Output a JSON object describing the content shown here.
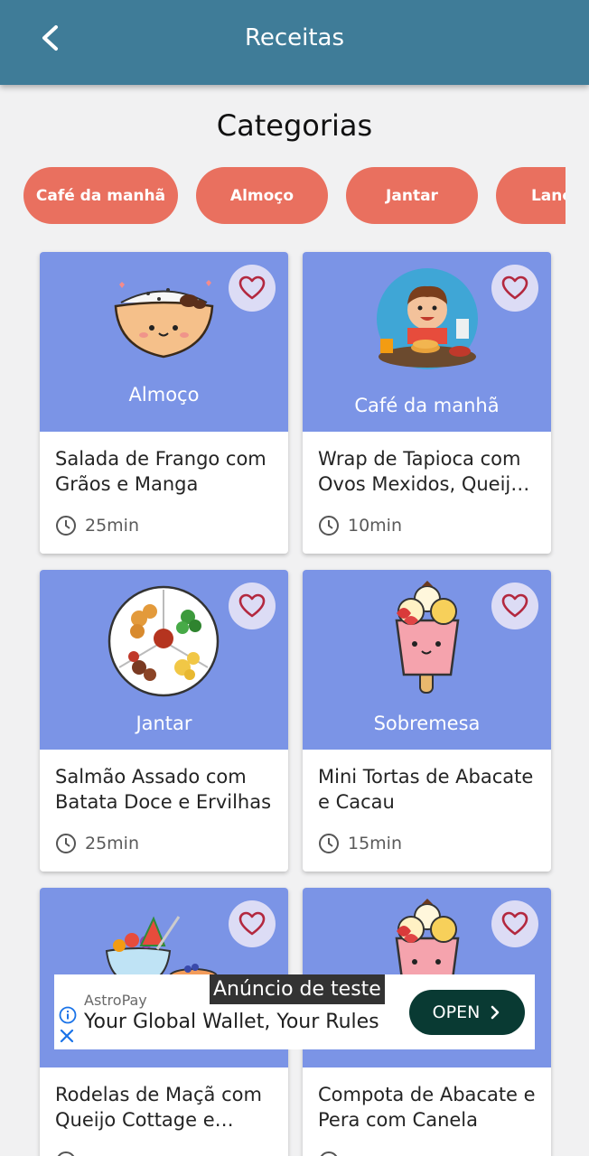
{
  "header": {
    "title": "Receitas",
    "back_icon": "chevron-left-icon"
  },
  "section_title": "Categorias",
  "categories": [
    "Café da manhã",
    "Almoço",
    "Jantar",
    "Lanche"
  ],
  "colors": {
    "appbar": "#3f7c98",
    "chip": "#e9705f",
    "card_image": "#7b94e6",
    "favorite_bg": "#dcdcf5",
    "heart": "#b3283f"
  },
  "recipes": [
    {
      "category": "Almoço",
      "title": "Salada de Frango com Grãos e Manga",
      "time": "25min",
      "image": "rice-bowl-icon",
      "favorite_icon": "heart-outline-icon"
    },
    {
      "category": "Café da manhã",
      "title": "Wrap de Tapioca com Ovos Mexidos, Queijo e Tomate",
      "time": "10min",
      "image": "breakfast-kid-icon",
      "favorite_icon": "heart-outline-icon"
    },
    {
      "category": "Jantar",
      "title": "Salmão Assado com Batata Doce e Ervilhas",
      "time": "25min",
      "image": "dinner-plate-icon",
      "favorite_icon": "heart-outline-icon"
    },
    {
      "category": "Sobremesa",
      "title": "Mini Tortas de Abacate e Cacau",
      "time": "15min",
      "image": "ice-cream-pop-icon",
      "favorite_icon": "heart-outline-icon"
    },
    {
      "category": "",
      "title": "Rodelas de Maçã com Queijo Cottage e Canela",
      "time": "",
      "image": "fruit-bowl-icon",
      "favorite_icon": "heart-outline-icon"
    },
    {
      "category": "",
      "title": "Compota de Abacate e Pera com Canela",
      "time": "",
      "image": "ice-cream-pop-icon",
      "favorite_icon": "heart-outline-icon"
    }
  ],
  "ad": {
    "badge": "Anúncio de teste",
    "brand": "AstroPay",
    "text": "Your Global Wallet, Your Rules",
    "cta": "OPEN",
    "info_icon": "info-icon",
    "close_icon": "close-icon"
  }
}
